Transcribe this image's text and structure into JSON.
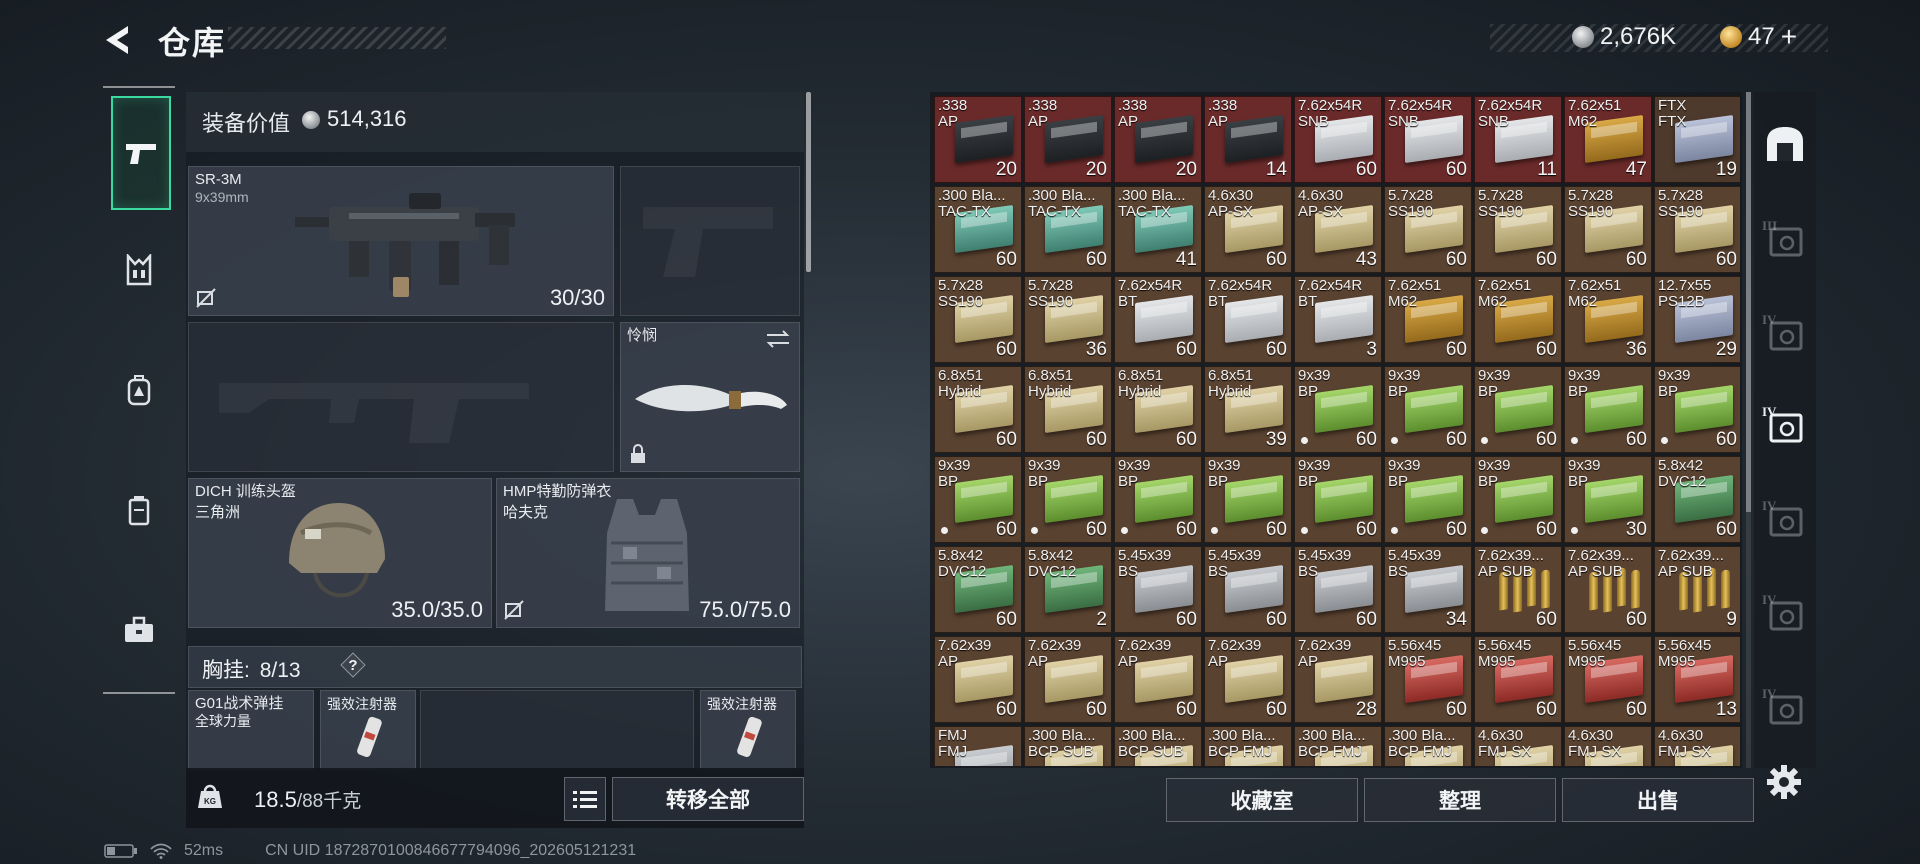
{
  "header": {
    "title": "仓库",
    "currency_silver": "2,676K",
    "currency_gold": "47",
    "add_label": "+"
  },
  "equipment": {
    "value_label": "装备价值",
    "value": "514,316",
    "primary": {
      "name": "SR-3M",
      "caliber": "9x39mm",
      "ammo": "30/30"
    },
    "melee": {
      "name": "怜悯"
    },
    "helmet": {
      "name": "DICH 训练头盔",
      "sub": "三角洲",
      "durability": "35.0/35.0"
    },
    "armor": {
      "name": "HMP特勤防弹衣",
      "sub": "哈夫克",
      "durability": "75.0/75.0"
    },
    "vest": {
      "label": "胸挂:",
      "count": "8/13",
      "help": "?"
    },
    "vest_items": [
      {
        "name": "G01战术弹挂",
        "sub": "全球力量"
      },
      {
        "name": "强效注射器"
      },
      {
        "name": "强效注射器"
      }
    ],
    "weight": {
      "value": "18.5",
      "capacity": "/88千克"
    },
    "transfer_all": "转移全部"
  },
  "ammo_grid": [
    [
      {
        "c": ".338",
        "v": "AP",
        "q": "20",
        "s": "red",
        "b": "black"
      },
      {
        "c": ".338",
        "v": "AP",
        "q": "20",
        "s": "red",
        "b": "black"
      },
      {
        "c": ".338",
        "v": "AP",
        "q": "20",
        "s": "red",
        "b": "black"
      },
      {
        "c": ".338",
        "v": "AP",
        "q": "14",
        "s": "red",
        "b": "black"
      },
      {
        "c": "7.62x54R",
        "v": "SNB",
        "q": "60",
        "s": "red",
        "b": "white"
      },
      {
        "c": "7.62x54R",
        "v": "SNB",
        "q": "60",
        "s": "red",
        "b": "white"
      },
      {
        "c": "7.62x54R",
        "v": "SNB",
        "q": "11",
        "s": "red",
        "b": "white"
      },
      {
        "c": "7.62x51",
        "v": "M62",
        "q": "47",
        "s": "red",
        "b": "gold"
      },
      {
        "c": "FTX",
        "v": "FTX",
        "q": "19",
        "s": "dark",
        "b": "blue"
      }
    ],
    [
      {
        "c": ".300 Bla...",
        "v": "TAC-TX",
        "q": "60",
        "b": "teal"
      },
      {
        "c": ".300 Bla...",
        "v": "TAC-TX",
        "q": "60",
        "b": "teal"
      },
      {
        "c": ".300 Bla...",
        "v": "TAC-TX",
        "q": "41",
        "b": "teal"
      },
      {
        "c": "4.6x30",
        "v": "AP-SX",
        "q": "60",
        "b": "cream"
      },
      {
        "c": "4.6x30",
        "v": "AP-SX",
        "q": "43",
        "b": "cream"
      },
      {
        "c": "5.7x28",
        "v": "SS190",
        "q": "60",
        "b": "cream"
      },
      {
        "c": "5.7x28",
        "v": "SS190",
        "q": "60",
        "b": "cream"
      },
      {
        "c": "5.7x28",
        "v": "SS190",
        "q": "60",
        "b": "cream"
      },
      {
        "c": "5.7x28",
        "v": "SS190",
        "q": "60",
        "b": "cream"
      }
    ],
    [
      {
        "c": "5.7x28",
        "v": "SS190",
        "q": "60",
        "b": "cream"
      },
      {
        "c": "5.7x28",
        "v": "SS190",
        "q": "36",
        "b": "cream"
      },
      {
        "c": "7.62x54R",
        "v": "BT",
        "q": "60",
        "b": "white"
      },
      {
        "c": "7.62x54R",
        "v": "BT",
        "q": "60",
        "b": "white"
      },
      {
        "c": "7.62x54R",
        "v": "BT",
        "q": "3",
        "b": "white"
      },
      {
        "c": "7.62x51",
        "v": "M62",
        "q": "60",
        "b": "gold"
      },
      {
        "c": "7.62x51",
        "v": "M62",
        "q": "60",
        "b": "gold"
      },
      {
        "c": "7.62x51",
        "v": "M62",
        "q": "36",
        "b": "gold"
      },
      {
        "c": "12.7x55",
        "v": "PS12B",
        "q": "29",
        "b": "blue"
      }
    ],
    [
      {
        "c": "6.8x51",
        "v": "Hybrid",
        "q": "60",
        "b": "cream"
      },
      {
        "c": "6.8x51",
        "v": "Hybrid",
        "q": "60",
        "b": "cream"
      },
      {
        "c": "6.8x51",
        "v": "Hybrid",
        "q": "60",
        "b": "cream"
      },
      {
        "c": "6.8x51",
        "v": "Hybrid",
        "q": "39",
        "b": "cream"
      },
      {
        "c": "9x39",
        "v": "BP",
        "q": "60",
        "b": "green",
        "d": 1
      },
      {
        "c": "9x39",
        "v": "BP",
        "q": "60",
        "b": "green",
        "d": 1
      },
      {
        "c": "9x39",
        "v": "BP",
        "q": "60",
        "b": "green",
        "d": 1
      },
      {
        "c": "9x39",
        "v": "BP",
        "q": "60",
        "b": "green",
        "d": 1
      },
      {
        "c": "9x39",
        "v": "BP",
        "q": "60",
        "b": "green",
        "d": 1
      }
    ],
    [
      {
        "c": "9x39",
        "v": "BP",
        "q": "60",
        "b": "green",
        "d": 1
      },
      {
        "c": "9x39",
        "v": "BP",
        "q": "60",
        "b": "green",
        "d": 1
      },
      {
        "c": "9x39",
        "v": "BP",
        "q": "60",
        "b": "green",
        "d": 1
      },
      {
        "c": "9x39",
        "v": "BP",
        "q": "60",
        "b": "green",
        "d": 1
      },
      {
        "c": "9x39",
        "v": "BP",
        "q": "60",
        "b": "green",
        "d": 1
      },
      {
        "c": "9x39",
        "v": "BP",
        "q": "60",
        "b": "green",
        "d": 1
      },
      {
        "c": "9x39",
        "v": "BP",
        "q": "60",
        "b": "green",
        "d": 1
      },
      {
        "c": "9x39",
        "v": "BP",
        "q": "30",
        "b": "green",
        "d": 1
      },
      {
        "c": "5.8x42",
        "v": "DVC12",
        "q": "60",
        "b": "green2"
      }
    ],
    [
      {
        "c": "5.8x42",
        "v": "DVC12",
        "q": "60",
        "b": "green2"
      },
      {
        "c": "5.8x42",
        "v": "DVC12",
        "q": "2",
        "b": "green2"
      },
      {
        "c": "5.45x39",
        "v": "BS",
        "q": "60",
        "b": "silver"
      },
      {
        "c": "5.45x39",
        "v": "BS",
        "q": "60",
        "b": "silver"
      },
      {
        "c": "5.45x39",
        "v": "BS",
        "q": "60",
        "b": "silver"
      },
      {
        "c": "5.45x39",
        "v": "BS",
        "q": "34",
        "b": "silver"
      },
      {
        "c": "7.62x39...",
        "v": "AP SUB",
        "q": "60",
        "b": "bullets"
      },
      {
        "c": "7.62x39...",
        "v": "AP SUB",
        "q": "60",
        "b": "bullets"
      },
      {
        "c": "7.62x39...",
        "v": "AP SUB",
        "q": "9",
        "b": "bullets"
      }
    ],
    [
      {
        "c": "7.62x39",
        "v": "AP",
        "q": "60",
        "b": "cream"
      },
      {
        "c": "7.62x39",
        "v": "AP",
        "q": "60",
        "b": "cream"
      },
      {
        "c": "7.62x39",
        "v": "AP",
        "q": "60",
        "b": "cream"
      },
      {
        "c": "7.62x39",
        "v": "AP",
        "q": "60",
        "b": "cream"
      },
      {
        "c": "7.62x39",
        "v": "AP",
        "q": "28",
        "b": "cream"
      },
      {
        "c": "5.56x45",
        "v": "M995",
        "q": "60",
        "b": "red"
      },
      {
        "c": "5.56x45",
        "v": "M995",
        "q": "60",
        "b": "red"
      },
      {
        "c": "5.56x45",
        "v": "M995",
        "q": "60",
        "b": "red"
      },
      {
        "c": "5.56x45",
        "v": "M995",
        "q": "13",
        "b": "red"
      }
    ],
    [
      {
        "c": "FMJ",
        "v": "FMJ",
        "q": "",
        "b": "silver"
      },
      {
        "c": ".300 Bla...",
        "v": "BCP SUB",
        "q": "",
        "b": "cream"
      },
      {
        "c": ".300 Bla...",
        "v": "BCP SUB",
        "q": "",
        "b": "cream"
      },
      {
        "c": ".300 Bla...",
        "v": "BCP FMJ",
        "q": "",
        "b": "cream"
      },
      {
        "c": ".300 Bla...",
        "v": "BCP FMJ",
        "q": "",
        "b": "cream"
      },
      {
        "c": ".300 Bla...",
        "v": "BCP FMJ",
        "q": "",
        "b": "cream"
      },
      {
        "c": "4.6x30",
        "v": "FMJ SX",
        "q": "",
        "b": "cream"
      },
      {
        "c": "4.6x30",
        "v": "FMJ SX",
        "q": "",
        "b": "cream"
      },
      {
        "c": "4.6x30",
        "v": "FMJ SX",
        "q": "",
        "b": "cream"
      }
    ]
  ],
  "footer_buttons": {
    "collection": "收藏室",
    "sort": "整理",
    "sell": "出售"
  },
  "side_containers": [
    {
      "level": ""
    },
    {
      "level": "III"
    },
    {
      "level": "IV"
    },
    {
      "level": "IV"
    },
    {
      "level": "IV"
    },
    {
      "level": "IV"
    },
    {
      "level": "IV"
    }
  ],
  "status_bar": {
    "ping": "52ms",
    "uid": "CN UID 1872870100846677794096_202605121231"
  }
}
